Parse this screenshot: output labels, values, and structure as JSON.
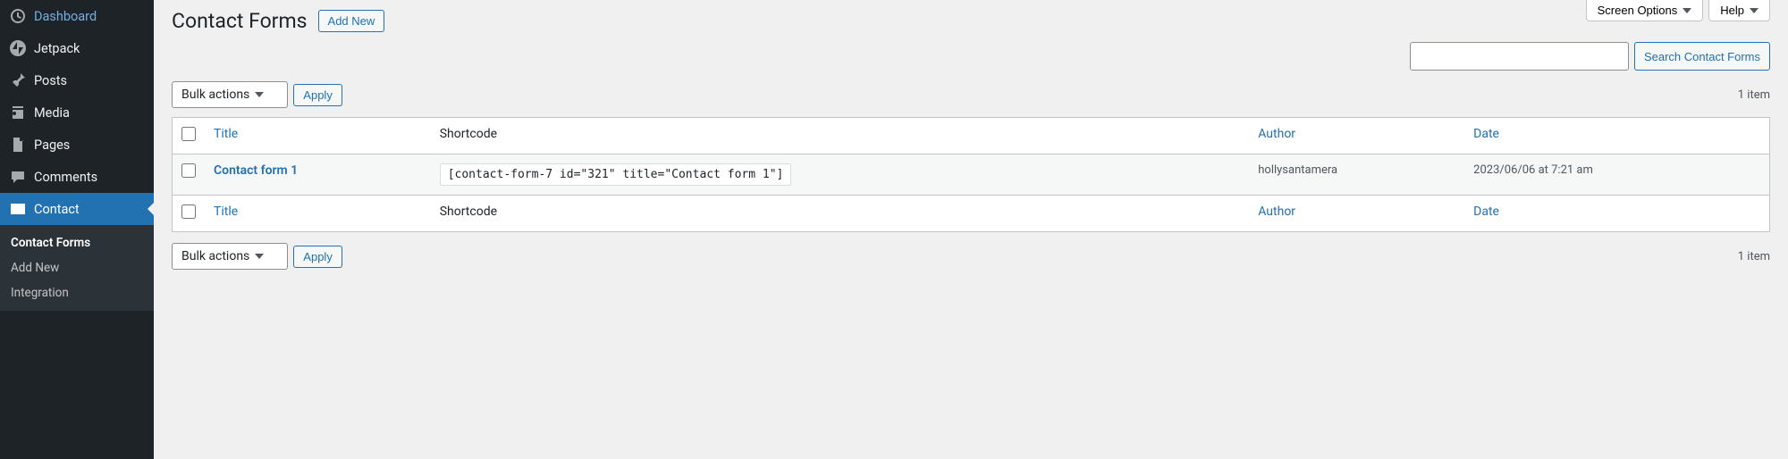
{
  "sidebar": {
    "items": [
      {
        "label": "Dashboard"
      },
      {
        "label": "Jetpack"
      },
      {
        "label": "Posts"
      },
      {
        "label": "Media"
      },
      {
        "label": "Pages"
      },
      {
        "label": "Comments"
      },
      {
        "label": "Contact"
      }
    ],
    "submenu": [
      {
        "label": "Contact Forms"
      },
      {
        "label": "Add New"
      },
      {
        "label": "Integration"
      }
    ]
  },
  "header": {
    "screen_options": "Screen Options",
    "help": "Help",
    "title": "Contact Forms",
    "add_new": "Add New"
  },
  "search": {
    "button": "Search Contact Forms"
  },
  "bulk": {
    "select_label": "Bulk actions",
    "apply": "Apply"
  },
  "pagination": {
    "count_label": "1 item"
  },
  "table": {
    "cols": {
      "title": "Title",
      "shortcode": "Shortcode",
      "author": "Author",
      "date": "Date"
    },
    "rows": [
      {
        "title": "Contact form 1",
        "shortcode": "[contact-form-7 id=\"321\" title=\"Contact form 1\"]",
        "author": "hollysantamera",
        "date": "2023/06/06 at 7:21 am"
      }
    ]
  }
}
